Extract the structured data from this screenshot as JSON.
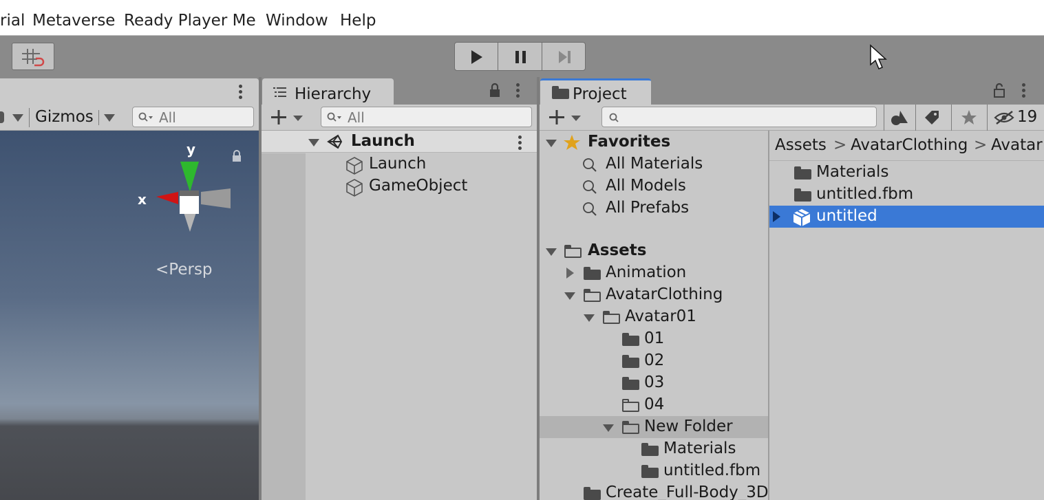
{
  "menubar": {
    "items": [
      "rial",
      "Metaverse",
      "Ready Player Me",
      "Window",
      "Help"
    ]
  },
  "toolbar": {
    "play_icon": "play-icon",
    "pause_icon": "pause-icon",
    "step_icon": "step-icon",
    "snap_icon": "grid-snap-icon"
  },
  "scene": {
    "gizmos_label": "Gizmos",
    "search_placeholder": "All",
    "axis_x": "x",
    "axis_y": "y",
    "persp_label": "Persp",
    "colors": {
      "x_axis": "#d01414",
      "y_axis": "#2eb82e",
      "sky_top": "#3e5270",
      "sky_horizon": "#8795a6",
      "ground": "#46484d"
    }
  },
  "hierarchy": {
    "tab_label": "Hierarchy",
    "search_placeholder": "All",
    "scene_name": "Launch",
    "objects": [
      "Launch",
      "GameObject"
    ]
  },
  "project": {
    "tab_label": "Project",
    "search_placeholder": "",
    "hidden_count": "19",
    "favorites_label": "Favorites",
    "favorites": [
      "All Materials",
      "All Models",
      "All Prefabs"
    ],
    "assets_label": "Assets",
    "tree": {
      "animation": "Animation",
      "avatar_clothing": "AvatarClothing",
      "avatar01": "Avatar01",
      "f01": "01",
      "f02": "02",
      "f03": "03",
      "f04": "04",
      "new_folder": "New Folder",
      "materials": "Materials",
      "untitled_fbm": "untitled.fbm",
      "create": "Create_Full-Body_3D"
    },
    "breadcrumb": [
      "Assets",
      "AvatarClothing",
      "Avatar"
    ],
    "content": [
      "Materials",
      "untitled.fbm",
      "untitled"
    ],
    "selected_color": "#3a79d6"
  }
}
